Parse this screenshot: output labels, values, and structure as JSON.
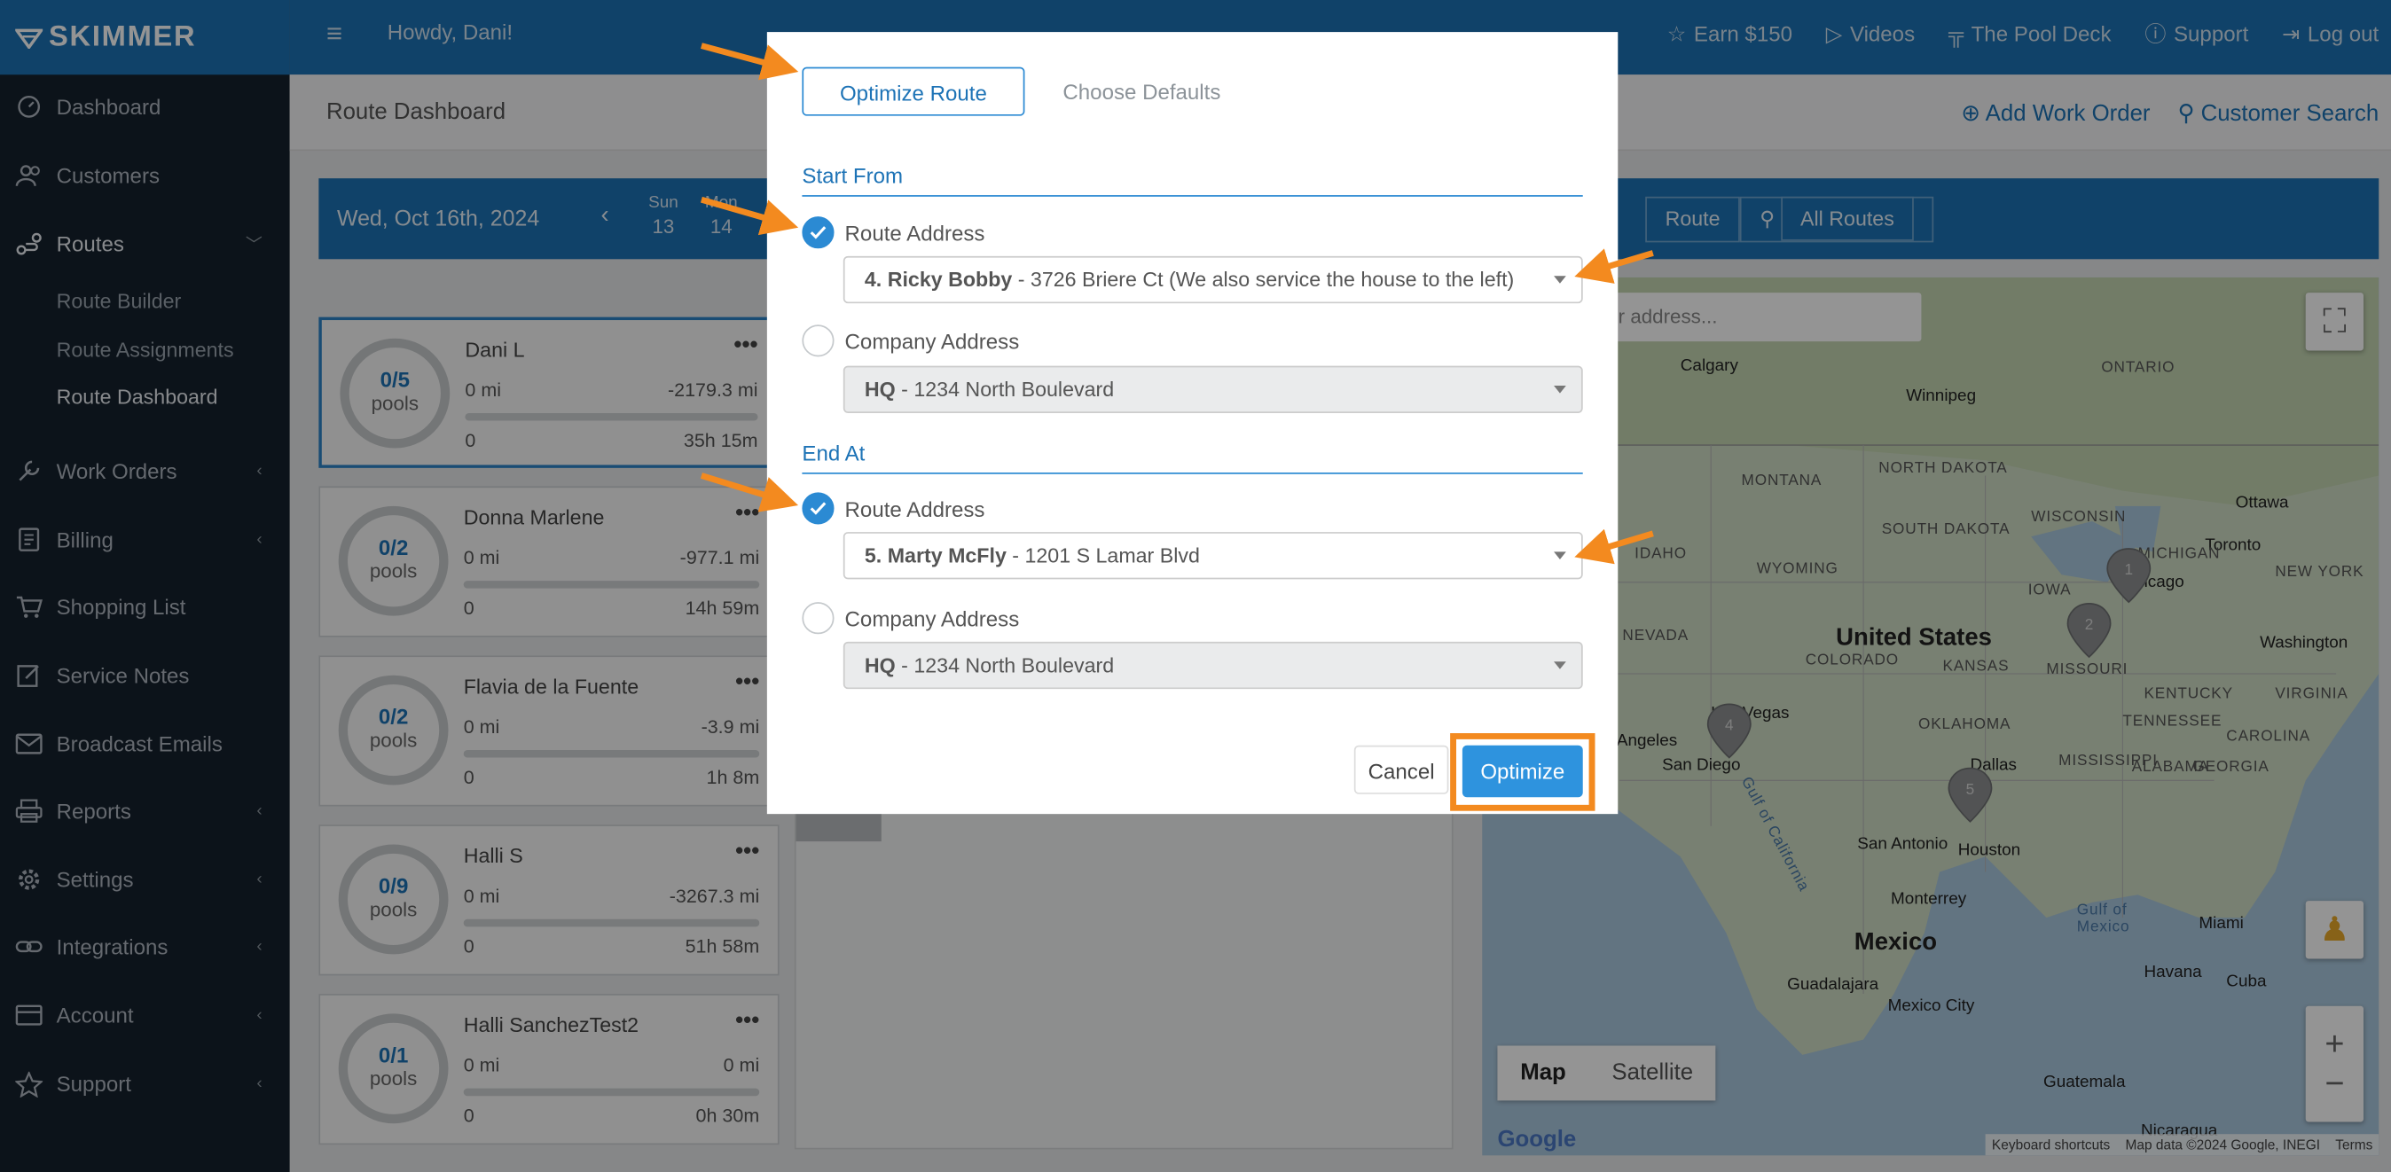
{
  "brand": {
    "name": "SKIMMER"
  },
  "sidebar": {
    "items": [
      {
        "label": "Dashboard",
        "icon": "dashboard-icon"
      },
      {
        "label": "Customers",
        "icon": "users-icon"
      },
      {
        "label": "Routes",
        "icon": "route-icon"
      },
      {
        "label": "Work Orders",
        "icon": "wrench-icon"
      },
      {
        "label": "Billing",
        "icon": "billing-icon"
      },
      {
        "label": "Shopping List",
        "icon": "cart-icon"
      },
      {
        "label": "Service Notes",
        "icon": "note-icon"
      },
      {
        "label": "Broadcast Emails",
        "icon": "email-icon"
      },
      {
        "label": "Reports",
        "icon": "printer-icon"
      },
      {
        "label": "Settings",
        "icon": "gear-icon"
      },
      {
        "label": "Integrations",
        "icon": "link-icon"
      },
      {
        "label": "Account",
        "icon": "account-icon"
      },
      {
        "label": "Support",
        "icon": "star-icon"
      }
    ],
    "routes_sub": [
      "Route Builder",
      "Route Assignments",
      "Route Dashboard"
    ]
  },
  "topbar": {
    "greeting": "Howdy, Dani!",
    "links": [
      "Earn $150",
      "Videos",
      "The Pool Deck",
      "Support",
      "Log out"
    ]
  },
  "page": {
    "title": "Route Dashboard",
    "actions": [
      "Add Work Order",
      "Customer Search"
    ]
  },
  "datebar": {
    "date": "Wed, Oct 16th, 2024",
    "days": [
      {
        "dow": "Sun",
        "num": "13"
      },
      {
        "dow": "Mon",
        "num": "14"
      }
    ],
    "route_buttons": [
      "Route",
      "All Routes"
    ]
  },
  "cards": [
    {
      "count": "0/5",
      "unit": "pools",
      "name": "Dani L",
      "miles": "0 mi",
      "delta": "-2179.3 mi",
      "stops": "0",
      "time": "35h 15m"
    },
    {
      "count": "0/2",
      "unit": "pools",
      "name": "Donna Marlene",
      "miles": "0 mi",
      "delta": "-977.1 mi",
      "stops": "0",
      "time": "14h 59m"
    },
    {
      "count": "0/2",
      "unit": "pools",
      "name": "Flavia de la Fuente",
      "miles": "0 mi",
      "delta": "-3.9 mi",
      "stops": "0",
      "time": "1h 8m"
    },
    {
      "count": "0/9",
      "unit": "pools",
      "name": "Halli S",
      "miles": "0 mi",
      "delta": "-3267.3 mi",
      "stops": "0",
      "time": "51h 58m"
    },
    {
      "count": "0/1",
      "unit": "pools",
      "name": "Halli SanchezTest2",
      "miles": "0 mi",
      "delta": "0 mi",
      "stops": "0",
      "time": "0h 30m"
    }
  ],
  "map": {
    "search_placeholder": "or address...",
    "types": [
      "Map",
      "Satellite"
    ],
    "labels": {
      "country_us": "United States",
      "country_mx": "Mexico",
      "calgary": "Calgary",
      "winnipeg": "Winnipeg",
      "ontario": "ONTARIO",
      "ottawa": "Ottawa",
      "toronto": "Toronto",
      "michigan": "MICHIGAN",
      "chicago": "Chicago",
      "newyork": "NEW YORK",
      "washington": "Washington",
      "montana": "MONTANA",
      "northdakota": "NORTH DAKOTA",
      "southdakota": "SOUTH DAKOTA",
      "idaho": "IDAHO",
      "wyoming": "WYOMING",
      "nevada": "NEVADA",
      "colorado": "COLORADO",
      "kansas": "KANSAS",
      "iowa": "IOWA",
      "missouri": "MISSOURI",
      "oklahoma": "OKLAHOMA",
      "lasvegas": "Las Vegas",
      "losangeles": "Los Angeles",
      "sandiego": "San Diego",
      "dallas": "Dallas",
      "houston": "Houston",
      "sanantonio": "San Antonio",
      "tennessee": "TENNESSEE",
      "kentucky": "KENTUCKY",
      "virginia": "VIRGINIA",
      "mississippi": "MISSISSIPPI",
      "alabama": "ALABAMA",
      "georgia": "GEORGIA",
      "carolina": "CAROLINA",
      "monterrey": "Monterrey",
      "guadalajara": "Guadalajara",
      "mexicocity": "Mexico City",
      "miami": "Miami",
      "havana": "Havana",
      "cuba": "Cuba",
      "gulf": "Gulf of Mexico",
      "gulfca": "Gulf of California",
      "guatemala": "Guatemala",
      "nicaragua": "Nicaragua",
      "wisconsin": "WISCONSIN"
    },
    "pins": [
      "1",
      "2",
      "4",
      "5"
    ],
    "footer": [
      "Keyboard shortcuts",
      "Map data ©2024 Google, INEGI",
      "Terms"
    ],
    "logo": "Google"
  },
  "modal": {
    "tabs": [
      "Optimize Route",
      "Choose Defaults"
    ],
    "start": {
      "heading": "Start From",
      "route_label": "Route Address",
      "route_value_bold": "4. Ricky Bobby",
      "route_value_rest": " - 3726 Briere Ct (We also service the house to the left)",
      "company_label": "Company Address",
      "company_value_bold": "HQ",
      "company_value_rest": " - 1234 North Boulevard"
    },
    "end": {
      "heading": "End At",
      "route_label": "Route Address",
      "route_value_bold": "5. Marty McFly",
      "route_value_rest": " - 1201 S Lamar Blvd",
      "company_label": "Company Address",
      "company_value_bold": "HQ",
      "company_value_rest": " - 1234 North Boulevard"
    },
    "cancel": "Cancel",
    "optimize": "Optimize"
  },
  "colors": {
    "brand_blue": "#1d73b6",
    "sidebar": "#16222d",
    "accent_orange": "#f38a1f",
    "button_blue": "#2e93de"
  }
}
